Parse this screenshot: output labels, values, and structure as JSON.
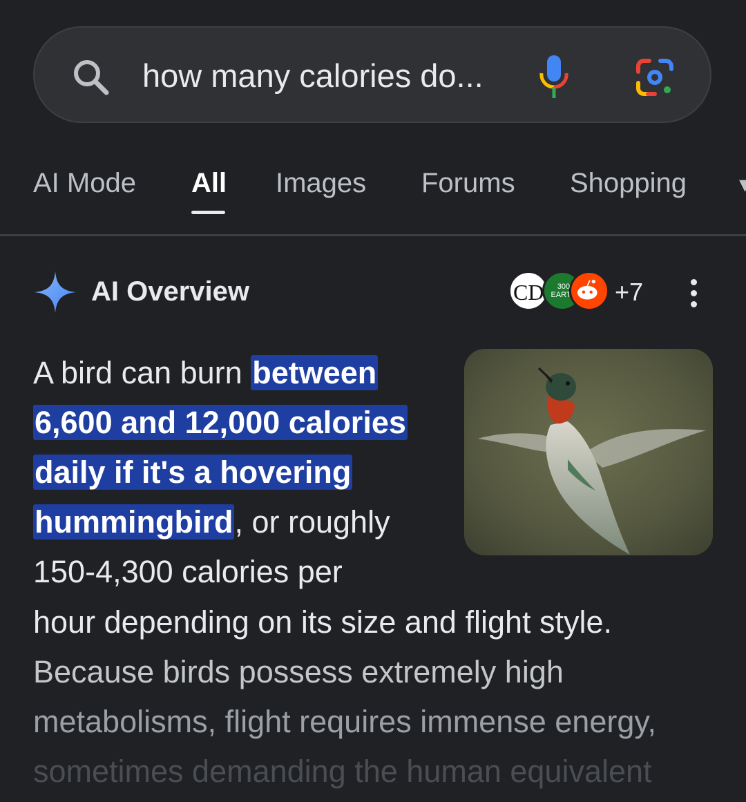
{
  "search": {
    "query": "how many calories do..."
  },
  "tabs": [
    {
      "label": "AI Mode",
      "active": false
    },
    {
      "label": "All",
      "active": true
    },
    {
      "label": "Images",
      "active": false
    },
    {
      "label": "Forums",
      "active": false
    },
    {
      "label": "Shopping",
      "active": false
    }
  ],
  "ai_overview": {
    "title": "AI Overview",
    "sources": {
      "first_label": "CD",
      "second_label": "300 EARTH",
      "more_count": "+7"
    },
    "lines": [
      {
        "plain": "A bird can burn ",
        "highlight": "between"
      },
      {
        "highlight": "6,600 and 12,000 calories"
      },
      {
        "highlight": "daily if it's a hovering"
      },
      {
        "highlight": "hummingbird",
        "plain": ", or roughly"
      },
      {
        "plain": "150-4,300 calories per"
      },
      {
        "plain": "hour depending on its size and flight style."
      },
      {
        "plain": "Because birds possess extremely high"
      },
      {
        "plain": "metabolisms, flight requires immense energy,"
      },
      {
        "plain": "sometimes demanding the human equivalent"
      }
    ]
  },
  "icons": [
    "search-icon",
    "microphone-icon",
    "google-lens-icon",
    "sparkle-icon",
    "more-vert-icon"
  ]
}
